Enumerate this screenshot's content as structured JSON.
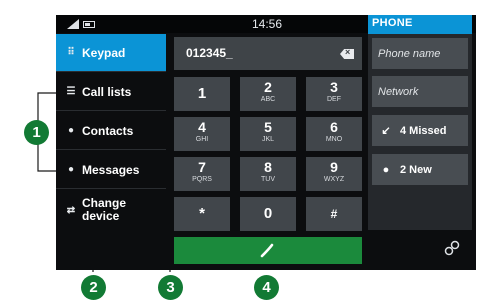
{
  "status_bar": {
    "time": "14:56",
    "panel_title": "PHONE"
  },
  "menu": {
    "items": [
      {
        "label": "Keypad",
        "icon": "keypad-icon",
        "active": true
      },
      {
        "label": "Call lists",
        "icon": "list-icon"
      },
      {
        "label": "Contacts",
        "icon": "contact-icon"
      },
      {
        "label": "Messages",
        "icon": "message-icon"
      },
      {
        "label_line1": "Change",
        "label_line2": "device",
        "icon": "change-device-icon"
      }
    ]
  },
  "dialer": {
    "number": "012345_",
    "keys": [
      {
        "digit": "1",
        "letters": ""
      },
      {
        "digit": "2",
        "letters": "ABC"
      },
      {
        "digit": "3",
        "letters": "DEF"
      },
      {
        "digit": "4",
        "letters": "GHI"
      },
      {
        "digit": "5",
        "letters": "JKL"
      },
      {
        "digit": "6",
        "letters": "MNO"
      },
      {
        "digit": "7",
        "letters": "PQRS"
      },
      {
        "digit": "8",
        "letters": "TUV"
      },
      {
        "digit": "9",
        "letters": "WXYZ"
      },
      {
        "digit": "*",
        "letters": ""
      },
      {
        "digit": "0",
        "letters": ""
      },
      {
        "digit": "#",
        "letters": ""
      }
    ]
  },
  "right_panel": {
    "phone_name": "Phone name",
    "network": "Network",
    "missed": "4 Missed",
    "new_messages": "2 New"
  },
  "callouts": [
    "1",
    "2",
    "3",
    "4"
  ],
  "colors": {
    "accent": "#0b94d6",
    "call": "#1b8a3c",
    "callout": "#127a34"
  }
}
